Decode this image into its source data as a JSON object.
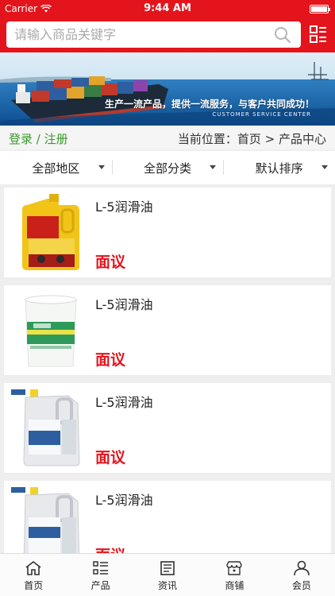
{
  "status_bar": {
    "carrier": "Carrier",
    "time": "9:44 AM"
  },
  "search": {
    "placeholder": "请输入商品关键字"
  },
  "banner": {
    "slogan": "生产一流产品，提供一流服务，与客户共同成功！",
    "subtitle": "CUSTOMER SERVICE CENTER"
  },
  "auth": {
    "login": "登录",
    "separator": "/",
    "register": "注册"
  },
  "breadcrumb": {
    "text": "当前位置：首页 > 产品中心"
  },
  "filters": [
    {
      "label": "全部地区"
    },
    {
      "label": "全部分类"
    },
    {
      "label": "默认排序"
    }
  ],
  "products": [
    {
      "name": "L-5润滑油",
      "price": "面议",
      "image": "yellow-oil-can"
    },
    {
      "name": "L-5润滑油",
      "price": "面议",
      "image": "white-green-oil-bucket"
    },
    {
      "name": "L-5润滑油",
      "price": "面议",
      "image": "white-oil-jug-blue-label"
    },
    {
      "name": "L-5润滑油",
      "price": "面议",
      "image": "white-oil-jug-blue-label"
    }
  ],
  "tabbar": [
    {
      "label": "首页",
      "icon": "home-icon"
    },
    {
      "label": "产品",
      "icon": "grid-list-icon"
    },
    {
      "label": "资讯",
      "icon": "news-icon"
    },
    {
      "label": "商铺",
      "icon": "shop-icon"
    },
    {
      "label": "会员",
      "icon": "user-icon"
    }
  ],
  "colors": {
    "brand_red": "#e4141c",
    "login_green": "#3a9a2a"
  }
}
